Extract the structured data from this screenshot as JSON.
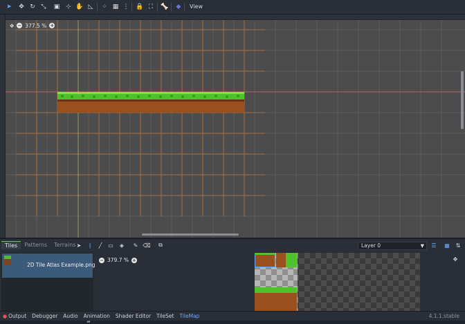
{
  "toolbar": {
    "view_label": "View"
  },
  "viewport": {
    "zoom": "377.5 %"
  },
  "bottom": {
    "tabs": [
      "Tiles",
      "Patterns",
      "Terrains"
    ],
    "layer": "Layer 0",
    "source_label": "2D Tile Atlas Example.png ...",
    "atlas_zoom": "379.7 %"
  },
  "status": {
    "items": [
      "Output",
      "Debugger",
      "Audio",
      "Animation",
      "Shader Editor",
      "TileSet",
      "TileMap"
    ],
    "version": "4.1.1.stable"
  },
  "colors": {
    "accent": "#6fa8ff",
    "grass": "#4fc12a",
    "dirt": "#9a4f1e",
    "grid": "#b8743c"
  }
}
